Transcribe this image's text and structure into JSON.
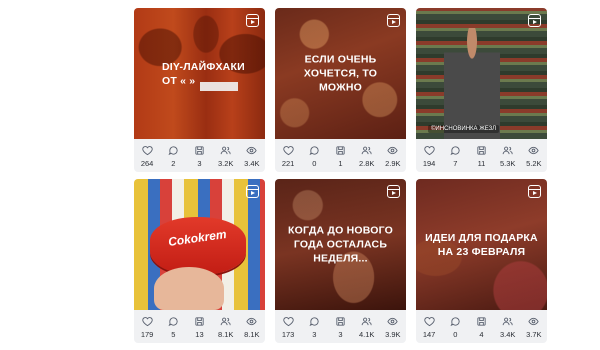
{
  "accent": "#8b1f1f",
  "cards": [
    {
      "overlay": "DIY-ЛАЙФХАКИ ОТ «           »",
      "thumb_icon": "reel-icon",
      "stats": {
        "likes": "264",
        "comments": "2",
        "saves": "3",
        "reach": "3.2K",
        "views": "3.4K"
      }
    },
    {
      "overlay": "ЕСЛИ ОЧЕНЬ ХОЧЕТСЯ, ТО МОЖНО",
      "thumb_icon": "reel-icon",
      "stats": {
        "likes": "221",
        "comments": "0",
        "saves": "1",
        "reach": "2.8K",
        "views": "2.9K"
      }
    },
    {
      "overlay": "",
      "caption": "©ИНСНОВИНКА ЖЕЗЛ",
      "thumb_icon": "reel-icon",
      "stats": {
        "likes": "194",
        "comments": "7",
        "saves": "11",
        "reach": "5.3K",
        "views": "5.2K"
      }
    },
    {
      "overlay": "",
      "product_text": "Cokokrem",
      "thumb_icon": "reel-icon",
      "stats": {
        "likes": "179",
        "comments": "5",
        "saves": "13",
        "reach": "8.1K",
        "views": "8.1K"
      }
    },
    {
      "overlay": "КОГДА ДО НОВОГО ГОДА ОСТАЛАСЬ НЕДЕЛЯ...",
      "thumb_icon": "reel-icon",
      "stats": {
        "likes": "173",
        "comments": "3",
        "saves": "3",
        "reach": "4.1K",
        "views": "3.9K"
      }
    },
    {
      "overlay": "ИДЕИ ДЛЯ ПОДАРКА НА 23 ФЕВРАЛЯ",
      "thumb_icon": "reel-icon",
      "stats": {
        "likes": "147",
        "comments": "0",
        "saves": "4",
        "reach": "3.4K",
        "views": "3.7K"
      }
    }
  ]
}
